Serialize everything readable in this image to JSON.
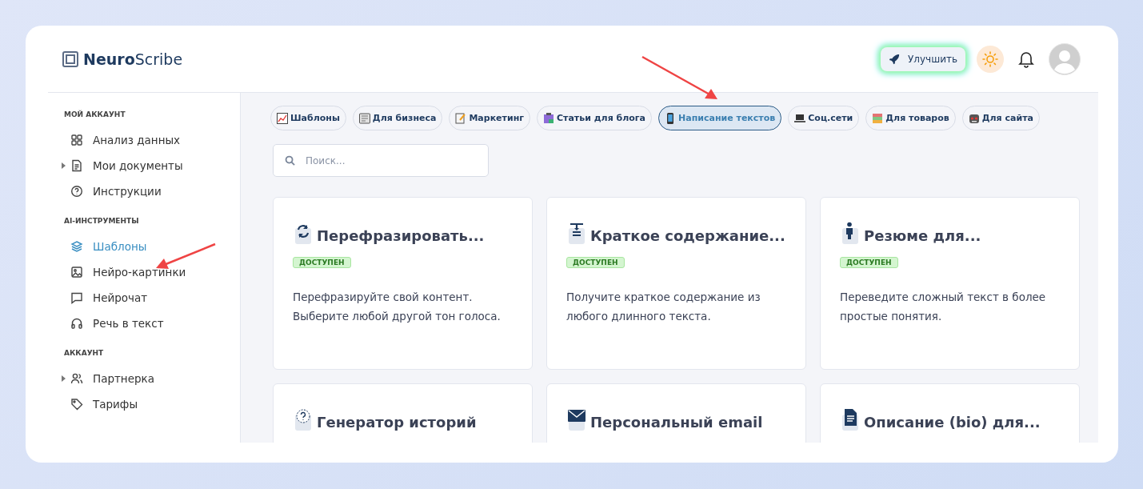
{
  "logo": {
    "bold": "Neuro",
    "rest": "Scribe"
  },
  "header": {
    "upgrade_label": "Улучшить"
  },
  "sidebar": {
    "sections": [
      {
        "title": "МОЙ АККАУНТ",
        "items": [
          {
            "label": "Анализ данных",
            "expandable": false,
            "selected": false
          },
          {
            "label": "Мои документы",
            "expandable": true,
            "selected": false
          },
          {
            "label": "Инструкции",
            "expandable": false,
            "selected": false
          }
        ]
      },
      {
        "title": "AI-ИНСТРУМЕНТЫ",
        "items": [
          {
            "label": "Шаблоны",
            "expandable": false,
            "selected": true
          },
          {
            "label": "Нейро-картинки",
            "expandable": false,
            "selected": false
          },
          {
            "label": "Нейрочат",
            "expandable": false,
            "selected": false
          },
          {
            "label": "Речь в текст",
            "expandable": false,
            "selected": false
          }
        ]
      },
      {
        "title": "АККАУНТ",
        "items": [
          {
            "label": "Партнерка",
            "expandable": true,
            "selected": false
          },
          {
            "label": "Тарифы",
            "expandable": false,
            "selected": false
          }
        ]
      }
    ]
  },
  "categories": [
    {
      "label": "Шаблоны",
      "selected": false
    },
    {
      "label": "Для бизнеса",
      "selected": false
    },
    {
      "label": "Маркетинг",
      "selected": false
    },
    {
      "label": "Статьи для блога",
      "selected": false
    },
    {
      "label": "Написание текстов",
      "selected": true
    },
    {
      "label": "Соц.сети",
      "selected": false
    },
    {
      "label": "Для товаров",
      "selected": false
    },
    {
      "label": "Для сайта",
      "selected": false
    }
  ],
  "search": {
    "placeholder": "Поиск..."
  },
  "templates": [
    {
      "title": "Перефразировать...",
      "badge": "ДОСТУПЕН",
      "description": "Перефразируйте свой контент. Выберите любой другой тон голоса."
    },
    {
      "title": "Краткое содержание...",
      "badge": "ДОСТУПЕН",
      "description": "Получите краткое содержание из любого длинного текста."
    },
    {
      "title": "Резюме для...",
      "badge": "ДОСТУПЕН",
      "description": "Переведите сложный текст в более простые понятия."
    },
    {
      "title": "Генератор историй"
    },
    {
      "title": "Персональный email"
    },
    {
      "title": "Описание (bio) для..."
    }
  ]
}
